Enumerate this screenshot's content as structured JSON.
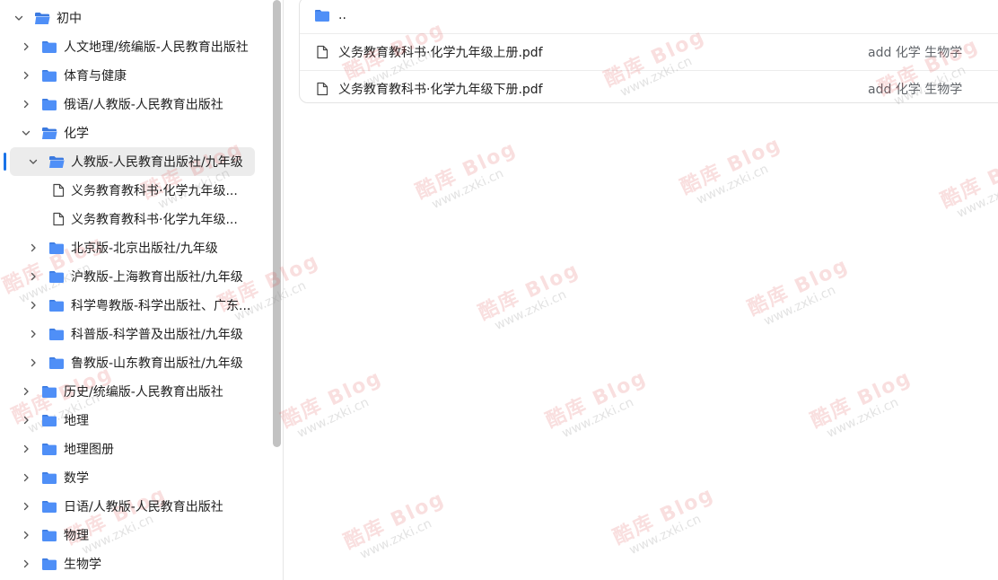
{
  "sidebar": {
    "items": [
      {
        "label": "初中",
        "type": "folder",
        "level": 0,
        "expanded": true,
        "icon": "folder-open-icon"
      },
      {
        "label": "人文地理/统编版-人民教育出版社",
        "type": "folder",
        "level": 1,
        "expanded": false,
        "icon": "folder-icon"
      },
      {
        "label": "体育与健康",
        "type": "folder",
        "level": 1,
        "expanded": false,
        "icon": "folder-icon"
      },
      {
        "label": "俄语/人教版-人民教育出版社",
        "type": "folder",
        "level": 1,
        "expanded": false,
        "icon": "folder-icon"
      },
      {
        "label": "化学",
        "type": "folder",
        "level": 1,
        "expanded": true,
        "icon": "folder-open-icon"
      },
      {
        "label": "人教版-人民教育出版社/九年级",
        "type": "folder",
        "level": 2,
        "expanded": true,
        "selected": true,
        "icon": "folder-open-icon"
      },
      {
        "label": "义务教育教科书·化学九年级...",
        "type": "file",
        "level": 3,
        "icon": "file-icon"
      },
      {
        "label": "义务教育教科书·化学九年级...",
        "type": "file",
        "level": 3,
        "icon": "file-icon"
      },
      {
        "label": "北京版-北京出版社/九年级",
        "type": "folder",
        "level": 2,
        "expanded": false,
        "icon": "folder-icon"
      },
      {
        "label": "沪教版-上海教育出版社/九年级",
        "type": "folder",
        "level": 2,
        "expanded": false,
        "icon": "folder-icon"
      },
      {
        "label": "科学粤教版-科学出版社、广东...",
        "type": "folder",
        "level": 2,
        "expanded": false,
        "icon": "folder-icon"
      },
      {
        "label": "科普版-科学普及出版社/九年级",
        "type": "folder",
        "level": 2,
        "expanded": false,
        "icon": "folder-icon"
      },
      {
        "label": "鲁教版-山东教育出版社/九年级",
        "type": "folder",
        "level": 2,
        "expanded": false,
        "icon": "folder-icon"
      },
      {
        "label": "历史/统编版-人民教育出版社",
        "type": "folder",
        "level": 1,
        "expanded": false,
        "icon": "folder-icon"
      },
      {
        "label": "地理",
        "type": "folder",
        "level": 1,
        "expanded": false,
        "icon": "folder-icon"
      },
      {
        "label": "地理图册",
        "type": "folder",
        "level": 1,
        "expanded": false,
        "icon": "folder-icon"
      },
      {
        "label": "数学",
        "type": "folder",
        "level": 1,
        "expanded": false,
        "icon": "folder-icon"
      },
      {
        "label": "日语/人教版-人民教育出版社",
        "type": "folder",
        "level": 1,
        "expanded": false,
        "icon": "folder-icon"
      },
      {
        "label": "物理",
        "type": "folder",
        "level": 1,
        "expanded": false,
        "icon": "folder-icon"
      },
      {
        "label": "生物学",
        "type": "folder",
        "level": 1,
        "expanded": false,
        "icon": "folder-icon"
      }
    ]
  },
  "files": {
    "parent": {
      "label": "..",
      "icon": "folder-icon"
    },
    "rows": [
      {
        "name": "义务教育教科书·化学九年级上册.pdf",
        "tags": "add 化学 生物学",
        "icon": "file-icon"
      },
      {
        "name": "义务教育教科书·化学九年级下册.pdf",
        "tags": "add 化学 生物学",
        "icon": "file-icon"
      }
    ]
  },
  "watermark": {
    "brand": "酷库 Blog",
    "url": "www.zxki.cn"
  },
  "colors": {
    "folder": "#4f8ff7",
    "folder_tab": "#3b7ae0",
    "accent": "#1a73e8",
    "selected_bg": "#ececec"
  }
}
